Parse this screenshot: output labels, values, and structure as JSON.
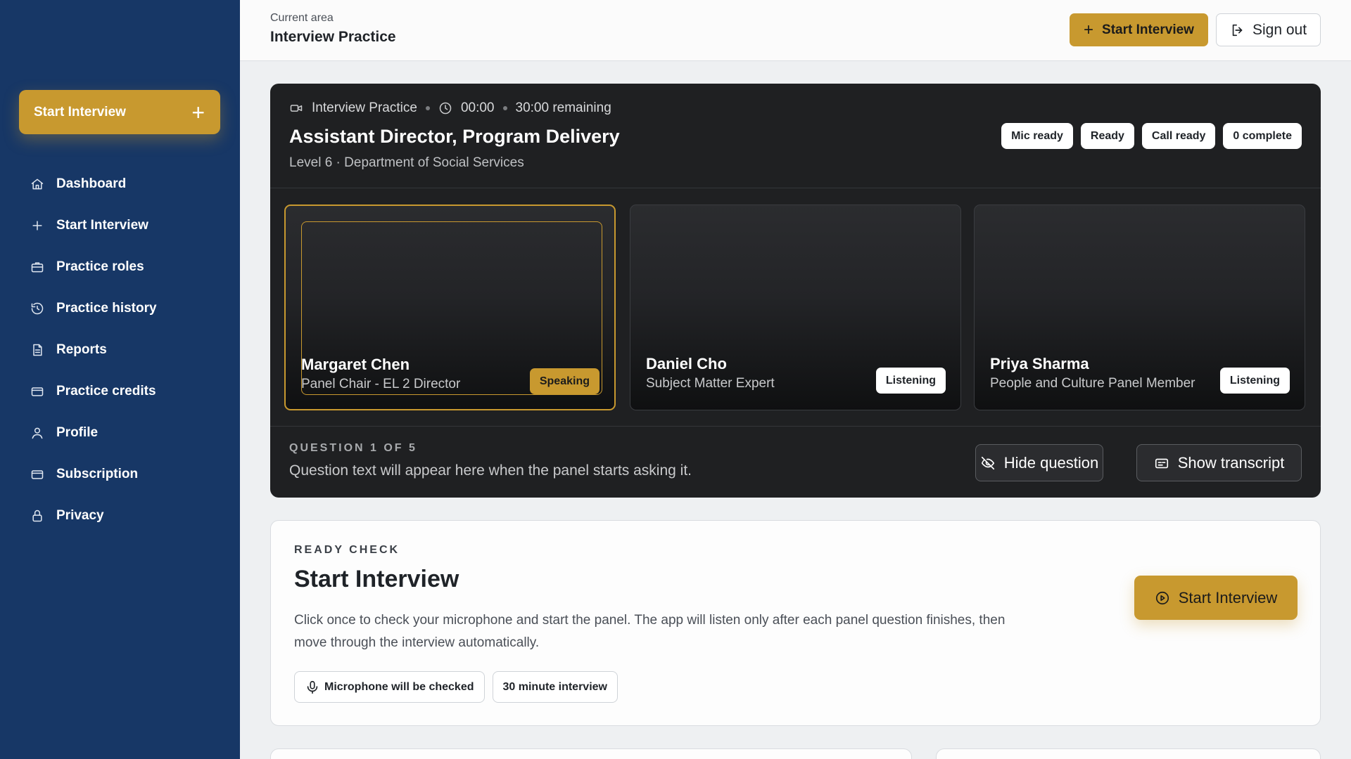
{
  "sidebar": {
    "cta_label": "Start Interview",
    "items": [
      {
        "label": "Dashboard",
        "icon": "home-icon"
      },
      {
        "label": "Start Interview",
        "icon": "plus-icon"
      },
      {
        "label": "Practice roles",
        "icon": "briefcase-icon"
      },
      {
        "label": "Practice history",
        "icon": "history-icon"
      },
      {
        "label": "Reports",
        "icon": "document-icon"
      },
      {
        "label": "Practice credits",
        "icon": "credit-card-icon"
      },
      {
        "label": "Profile",
        "icon": "user-icon"
      },
      {
        "label": "Subscription",
        "icon": "credit-card-icon"
      },
      {
        "label": "Privacy",
        "icon": "lock-icon"
      }
    ]
  },
  "header": {
    "subtitle": "Current area",
    "title": "Interview Practice",
    "start_label": "Start Interview",
    "signout_label": "Sign out"
  },
  "call": {
    "mode": "Interview Practice",
    "elapsed": "00:00",
    "remaining": "30:00 remaining",
    "title": "Assistant Director, Program Delivery",
    "subtitle": "Level 6 · Department of Social Services",
    "chips": [
      "Mic ready",
      "Ready",
      "Call ready",
      "0 complete"
    ],
    "panelists": [
      {
        "name": "Margaret Chen",
        "role": "Panel Chair - EL 2 Director",
        "status": "Speaking"
      },
      {
        "name": "Daniel Cho",
        "role": "Subject Matter Expert",
        "status": "Listening"
      },
      {
        "name": "Priya Sharma",
        "role": "People and Culture Panel Member",
        "status": "Listening"
      }
    ],
    "question_label": "QUESTION 1 OF 5",
    "question_text": "Question text will appear here when the panel starts asking it.",
    "hide_question_label": "Hide question",
    "show_transcript_label": "Show transcript"
  },
  "ready": {
    "label": "READY CHECK",
    "title": "Start Interview",
    "description": "Click once to check your microphone and start the panel. The app will listen only after each panel question finishes, then move through the interview automatically.",
    "pills": [
      "Microphone will be checked",
      "30 minute interview"
    ],
    "button_label": "Start Interview"
  },
  "colors": {
    "sidebar_bg": "#173766",
    "accent": "#c8992f",
    "call_bg": "#1f2022"
  }
}
